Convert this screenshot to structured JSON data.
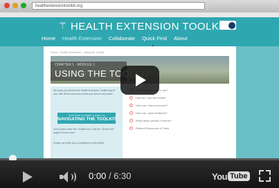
{
  "browser": {
    "url": "healthextensiontoolkit.org"
  },
  "site": {
    "logo_glyph": "⚚",
    "title": "HEALTH EXTENSION TOOLKIT",
    "nav": [
      "Home",
      "Health Extension",
      "Collaborate",
      "Quick Find",
      "About"
    ],
    "breadcrumb": "Home / Health Extension / Using the Toolkit",
    "hero_chapter": "CHAPTER 1 · MODULE 1",
    "hero_title": "USING THE TOOLKIT",
    "intro_text": "We hope you will find the Health Extension Toolkit easy to use, with all the resources which you need in one place.",
    "button_top": "Click here to watch a video on",
    "button_label": "NAVIGATING THE TOOLKIT",
    "side_text_1": "You'll want to take the \"Guided tour\" and the \"Quick Find\" pages to learn more.",
    "side_text_2": "Finally, we invite you to contribute to this toolkit.",
    "right_list": [
      "Is the toolkit useful to me?",
      "How do I use the toolkit?",
      "How can I add resources?",
      "How can I give feedback?",
      "What about privacy of terms?",
      "Related Resources & Tools"
    ]
  },
  "player": {
    "current_time": "0:00",
    "duration": "/ 6:30",
    "progress_percent": 0,
    "logo_you": "You",
    "logo_tube": "Tube"
  }
}
